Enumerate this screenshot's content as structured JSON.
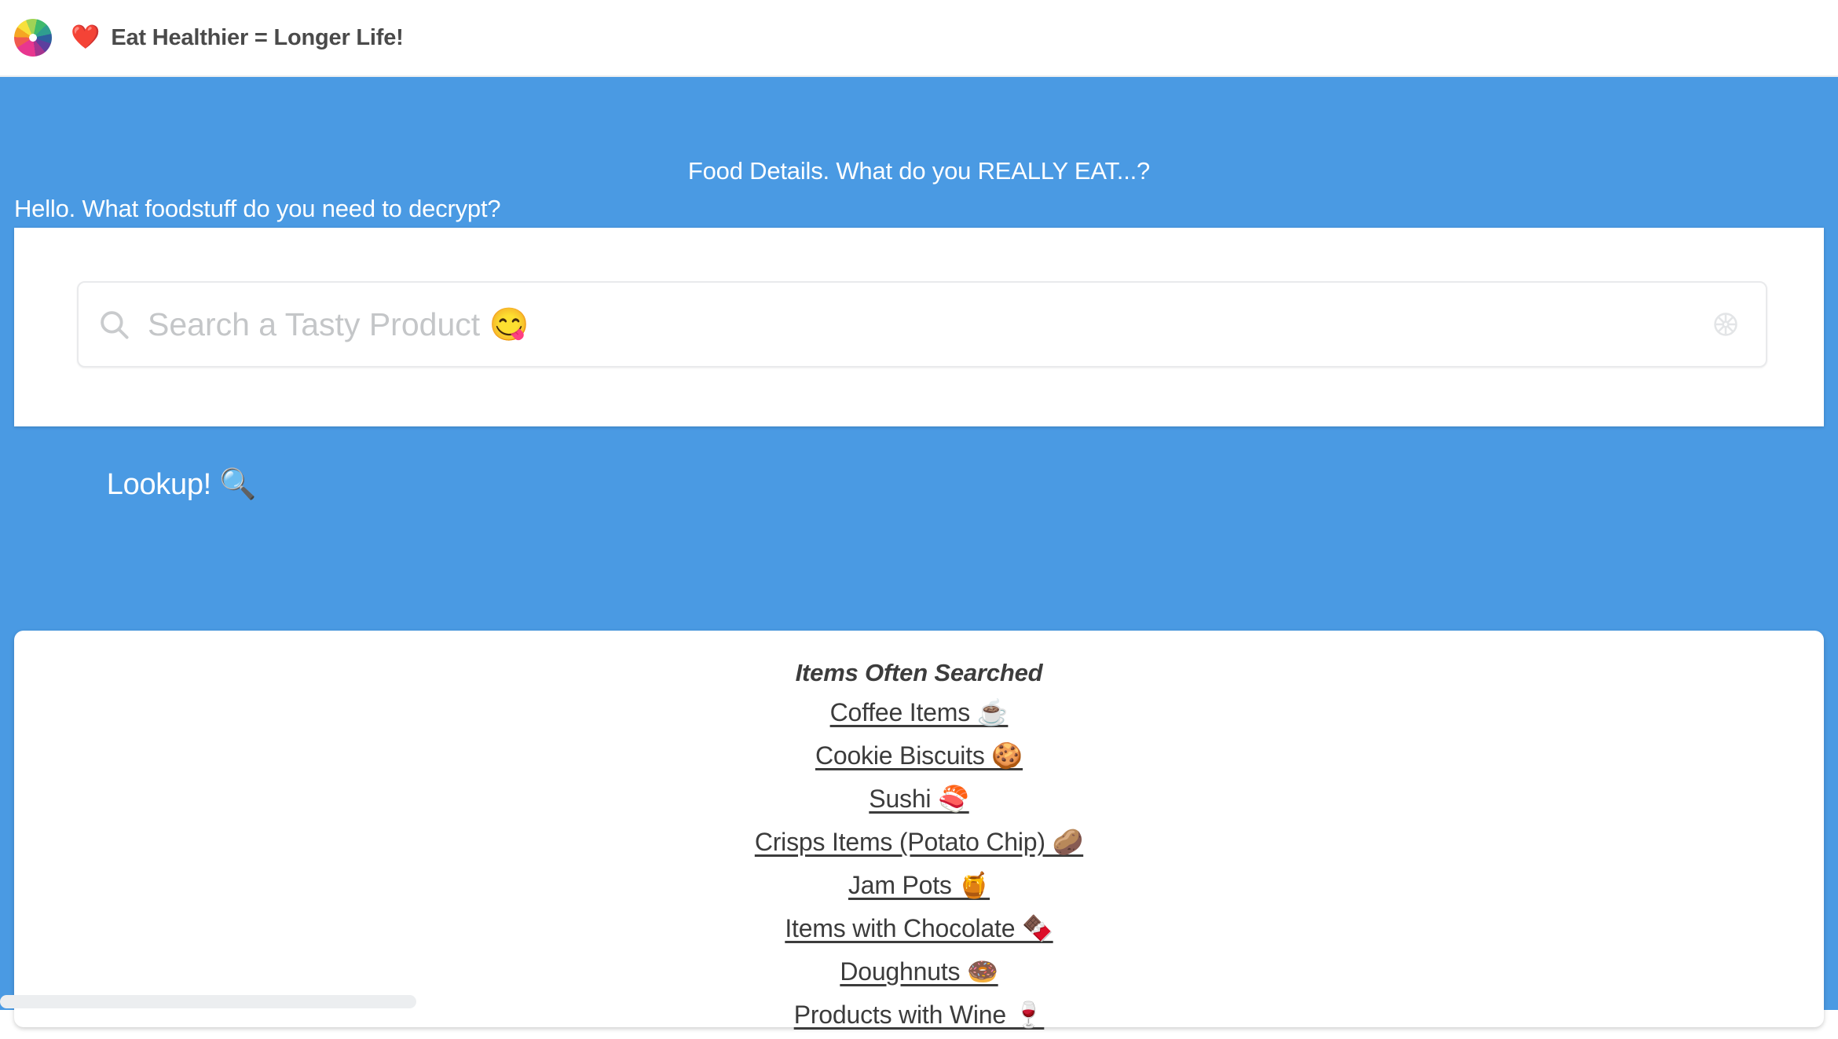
{
  "header": {
    "logo_icon": "colorful-flower-burst-logo",
    "heart_emoji": "❤️",
    "title": "Eat Healthier = Longer Life!"
  },
  "hero": {
    "title": "Food Details. What do you REALLY EAT...?",
    "subtitle": "Hello. What foodstuff do you need to decrypt?",
    "background_color": "#4a9ae3"
  },
  "search": {
    "search_icon": "search-icon",
    "placeholder": "Search a Tasty Product 😋",
    "value": "",
    "clear_icon": "asterisk-circle-icon",
    "submit_label": "Lookup! 🔍",
    "submit_color": "#4a9ae3"
  },
  "popular": {
    "heading": "Items Often Searched",
    "items": [
      {
        "label": "Coffee Items ☕"
      },
      {
        "label": "Cookie Biscuits 🍪"
      },
      {
        "label": "Sushi 🍣"
      },
      {
        "label": "Crisps Items (Potato Chip) 🥔"
      },
      {
        "label": "Jam Pots 🍯"
      },
      {
        "label": "Items with Chocolate 🍫"
      },
      {
        "label": "Doughnuts 🍩"
      },
      {
        "label": "Products with Wine 🍷"
      }
    ]
  },
  "scrollbar": {
    "orientation": "horizontal",
    "thumb_color": "#eceef0"
  }
}
